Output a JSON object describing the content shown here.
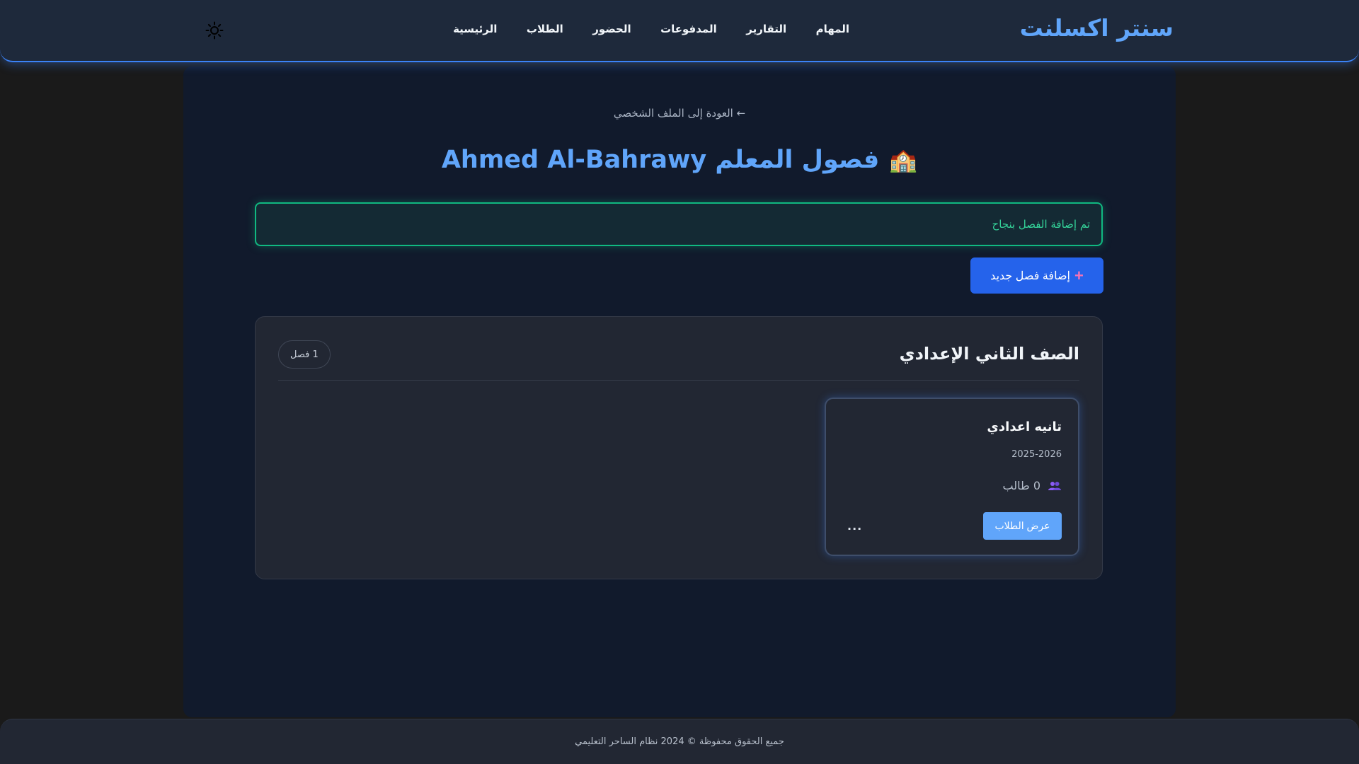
{
  "header": {
    "brand": "سنتر اكسلنت",
    "nav": [
      "الرئيسية",
      "الطلاب",
      "الحضور",
      "المدفوعات",
      "التقارير",
      "المهام"
    ],
    "theme_icon": "sun-icon"
  },
  "main": {
    "back_link": "← العودة إلى الملف الشخصي",
    "title_emoji": "🏫",
    "title": "فصول المعلم Ahmed Al-Bahrawy",
    "alert": "تم إضافة الفصل بنجاح",
    "add_button": "إضافة فصل جديد",
    "add_icon": "plus-icon"
  },
  "grade_section": {
    "title": "الصف الثاني الإعدادي",
    "count_badge": "1 فصل",
    "classes": [
      {
        "name": "تانيه اعدادي",
        "year": "2025-2026",
        "students": "0 طالب",
        "students_icon": "people-icon",
        "view_button": "عرض الطلاب",
        "more": "..."
      }
    ]
  },
  "footer": {
    "text": "جميع الحقوق محفوظة © 2024 نظام الساحر التعليمي"
  },
  "colors": {
    "accent": "#60a5fa",
    "primary_button": "#2563eb",
    "success": "#10b981",
    "background": "#111a2c"
  }
}
